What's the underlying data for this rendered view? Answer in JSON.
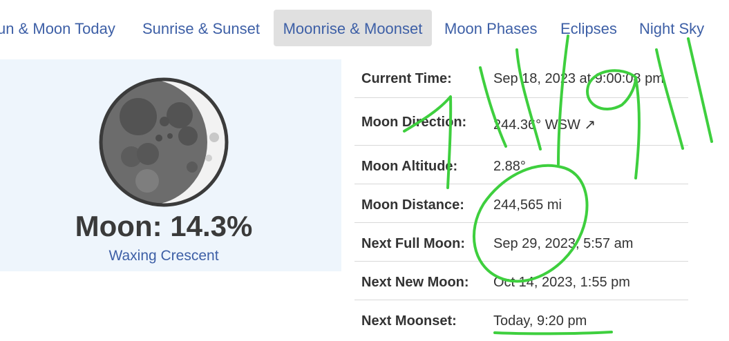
{
  "nav": {
    "tabs": [
      {
        "label": "un & Moon Today",
        "active": false
      },
      {
        "label": "Sunrise & Sunset",
        "active": false
      },
      {
        "label": "Moonrise & Moonset",
        "active": true
      },
      {
        "label": "Moon Phases",
        "active": false
      },
      {
        "label": "Eclipses",
        "active": false
      },
      {
        "label": "Night Sky",
        "active": false
      }
    ]
  },
  "moon": {
    "title": "Moon: 14.3%",
    "phase": "Waxing Crescent"
  },
  "info": {
    "rows": [
      {
        "label": "Current Time:",
        "value": "Sep 18, 2023 at 9:00:08 pm"
      },
      {
        "label": "Moon Direction:",
        "value": "244.36° WSW ↗"
      },
      {
        "label": "Moon Altitude:",
        "value": "2.88°"
      },
      {
        "label": "Moon Distance:",
        "value": "244,565 mi"
      },
      {
        "label": "Next Full Moon:",
        "value": "Sep 29, 2023, 5:57 am"
      },
      {
        "label": "Next New Moon:",
        "value": "Oct 14, 2023, 1:55 pm"
      },
      {
        "label": "Next Moonset:",
        "value": "Today, 9:20 pm"
      }
    ]
  },
  "colors": {
    "link": "#3d5fa6",
    "panel_bg": "#eef5fc",
    "active_tab_bg": "#e0e0e0",
    "annotation": "#3ecf3e"
  }
}
